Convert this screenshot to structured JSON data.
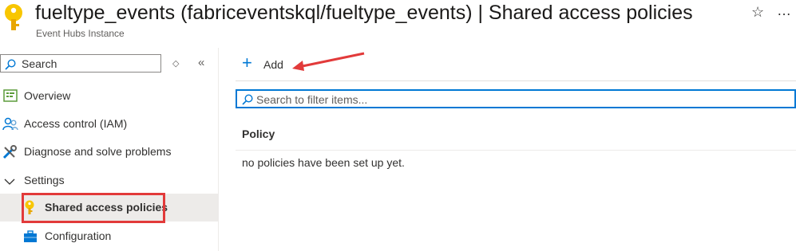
{
  "header": {
    "title": "fueltype_events (fabriceventskql/fueltype_events) | Shared access policies",
    "subtitle": "Event Hubs Instance",
    "star_glyph": "☆",
    "more_glyph": "…"
  },
  "sidebar": {
    "search_placeholder": "Search",
    "items": [
      {
        "label": "Overview",
        "icon": "overview-icon"
      },
      {
        "label": "Access control (IAM)",
        "icon": "people-icon"
      },
      {
        "label": "Diagnose and solve problems",
        "icon": "wrench-icon"
      },
      {
        "label": "Settings",
        "icon": "chevron-down-icon"
      },
      {
        "label": "Shared access policies",
        "icon": "key-icon",
        "selected": true
      },
      {
        "label": "Configuration",
        "icon": "toolbox-icon"
      }
    ]
  },
  "toolbar": {
    "add_label": "Add"
  },
  "filter": {
    "placeholder": "Search to filter items..."
  },
  "table": {
    "columns": [
      "Policy"
    ],
    "empty_message": "no policies have been set up yet."
  },
  "colors": {
    "accent": "#0078d4",
    "annotation": "#e23a3a",
    "key": "#f8c600"
  }
}
